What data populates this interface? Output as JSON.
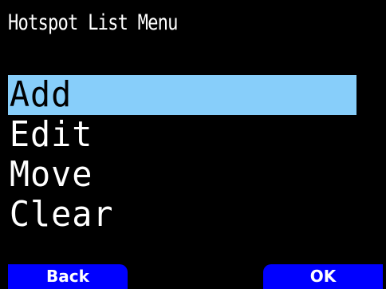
{
  "header": {
    "title": "Hotspot List Menu"
  },
  "menu": {
    "items": [
      {
        "label": "Add",
        "selected": true
      },
      {
        "label": "Edit",
        "selected": false
      },
      {
        "label": "Move",
        "selected": false
      },
      {
        "label": "Clear",
        "selected": false
      }
    ]
  },
  "softkeys": {
    "left_label": "Back",
    "right_label": "OK"
  },
  "colors": {
    "background": "#000000",
    "selection_highlight": "#87cefa",
    "softkey_background": "#0000ff",
    "text": "#ffffff"
  }
}
